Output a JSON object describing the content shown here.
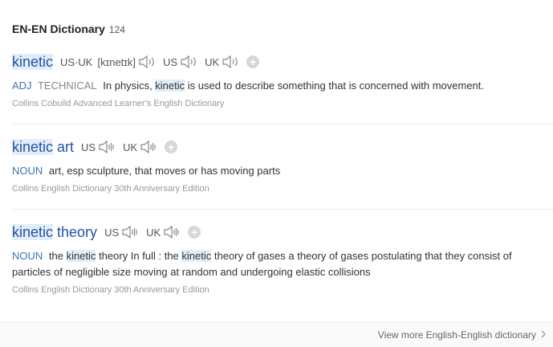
{
  "header": {
    "title": "EN-EN Dictionary",
    "count": "124"
  },
  "entries": [
    {
      "word_hl": "kinetic",
      "word_rest": "",
      "phonetic_label": "US·UK",
      "phonetic": "[kɪnetɪk]",
      "us_label": "US",
      "uk_label": "UK",
      "add_label": "+",
      "pos": "ADJ",
      "tag": "TECHNICAL",
      "def_parts": [
        "In physics, ",
        "kinetic",
        " is used to describe something that is concerned with movement."
      ],
      "source": "Collins Cobuild Advanced Learner's English Dictionary"
    },
    {
      "word_hl": "kinetic",
      "word_rest": " art",
      "us_label": "US",
      "uk_label": "UK",
      "add_label": "+",
      "pos": "NOUN",
      "definition": "art, esp sculpture, that moves or has moving parts",
      "source": "Collins English Dictionary 30th Anniversary Edition"
    },
    {
      "word_hl": "kinetic",
      "word_rest": " theory",
      "us_label": "US",
      "uk_label": "UK",
      "add_label": "+",
      "pos": "NOUN",
      "def_parts": [
        "the ",
        "kinetic",
        " theory In full : the ",
        "kinetic",
        " theory of gases a theory of gases postulating that they consist of particles of negligible size moving at random and undergoing elastic collisions"
      ],
      "source": "Collins English Dictionary 30th Anniversary Edition"
    }
  ],
  "footer": {
    "more_label": "View more English-English dictionary"
  },
  "icons": {
    "speaker": "speaker-icon",
    "add": "plus-icon",
    "chevron": "chevron-right-icon"
  },
  "colors": {
    "word": "#2152a3",
    "pos": "#3c73b4",
    "highlight": "#e3edf9"
  }
}
